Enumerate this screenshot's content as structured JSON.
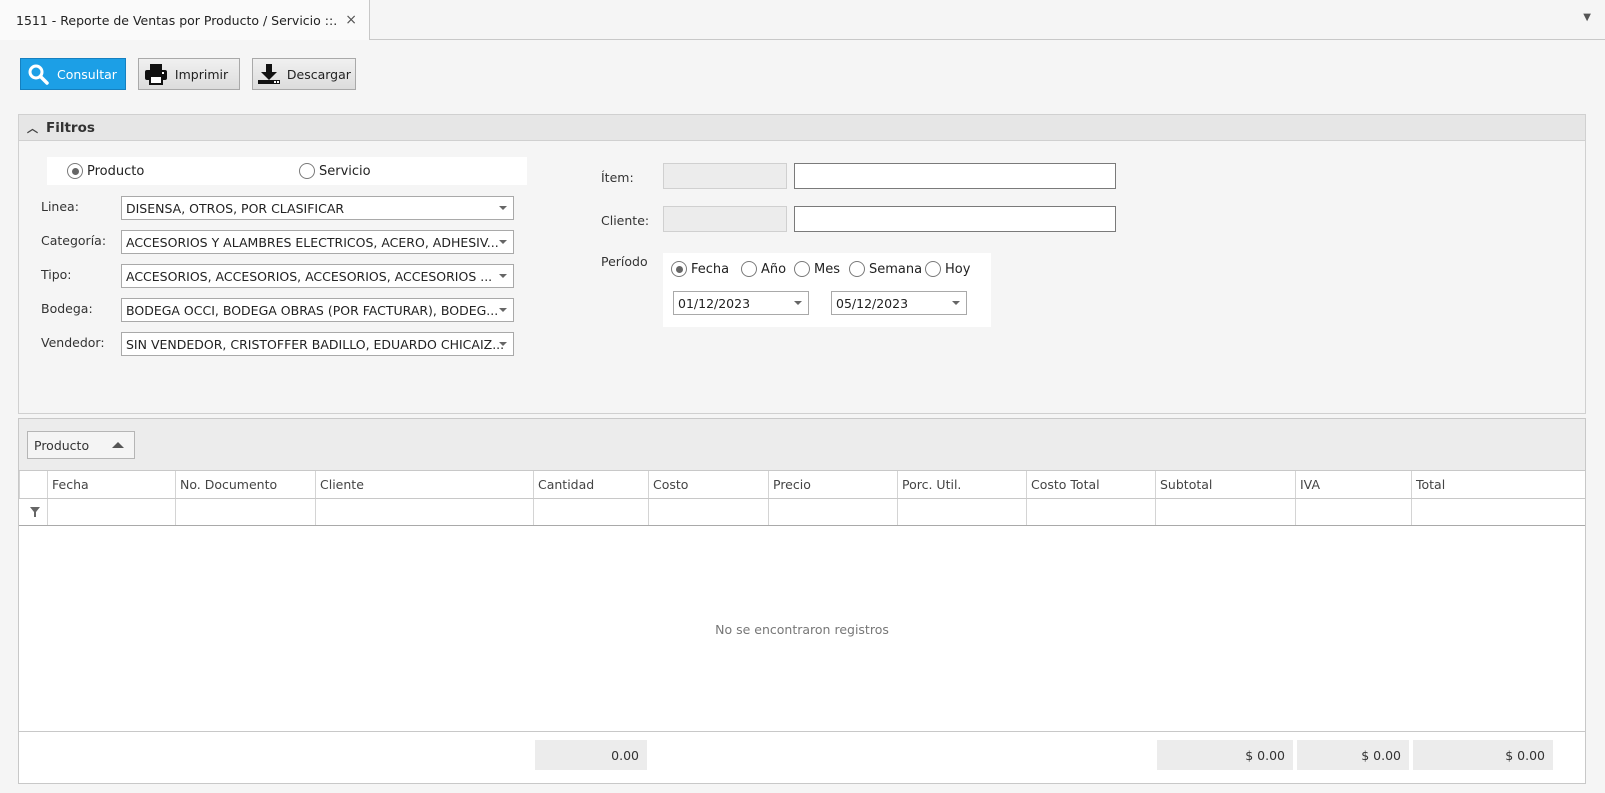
{
  "tab": {
    "title": "1511 - Reporte de Ventas por Producto / Servicio ::.",
    "close": "×",
    "menu": "▼"
  },
  "toolbar": {
    "consultar": "Consultar",
    "imprimir": "Imprimir",
    "descargar": "Descargar"
  },
  "filtros": {
    "title": "Filtros",
    "tipo_radio": {
      "producto": "Producto",
      "servicio": "Servicio",
      "selected": "producto"
    },
    "linea": {
      "label": "Linea:",
      "value": "DISENSA, OTROS, POR CLASIFICAR"
    },
    "categoria": {
      "label": "Categoría:",
      "value": "ACCESORIOS Y ALAMBRES ELECTRICOS, ACERO, ADHESIV..."
    },
    "tipo": {
      "label": "Tipo:",
      "value": "ACCESORIOS, ACCESORIOS, ACCESORIOS, ACCESORIOS ..."
    },
    "bodega": {
      "label": "Bodega:",
      "value": "BODEGA OCCI, BODEGA OBRAS (POR FACTURAR), BODEG..."
    },
    "vendedor": {
      "label": "Vendedor:",
      "value": "SIN VENDEDOR, CRISTOFFER BADILLO, EDUARDO CHICAIZ..."
    },
    "item": {
      "label": "Ítem:",
      "code": "",
      "desc": ""
    },
    "cliente": {
      "label": "Cliente:",
      "code": "",
      "desc": ""
    },
    "periodo": {
      "label": "Período",
      "options": [
        "Fecha",
        "Año",
        "Mes",
        "Semana",
        "Hoy"
      ],
      "selected": "Fecha",
      "desde": "01/12/2023",
      "hasta": "05/12/2023"
    }
  },
  "grid": {
    "group_by": "Producto",
    "columns": [
      "Fecha",
      "No. Documento",
      "Cliente",
      "Cantidad",
      "Costo",
      "Precio",
      "Porc. Util.",
      "Costo Total",
      "Subtotal",
      "IVA",
      "Total"
    ],
    "empty_message": "No se encontraron registros",
    "totals": {
      "cantidad": "0.00",
      "subtotal": "$ 0.00",
      "iva": "$ 0.00",
      "total": "$ 0.00"
    }
  },
  "colors": {
    "primary_button": "#1c9fe6"
  }
}
